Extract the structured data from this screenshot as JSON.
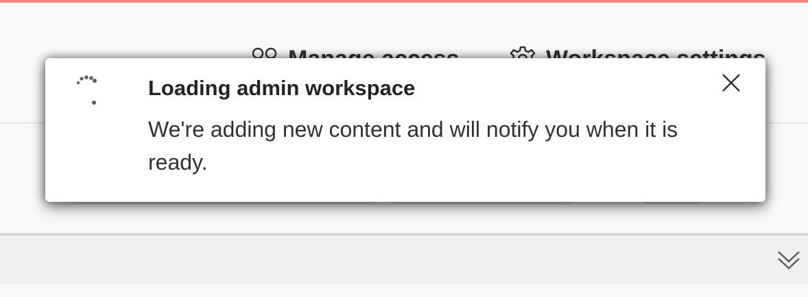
{
  "header": {
    "manage_access_label": "Manage access",
    "workspace_settings_label": "Workspace settings"
  },
  "toast": {
    "title": "Loading admin workspace",
    "message": "We're adding new content and will notify you when it is ready.",
    "spinner_icon": "loading-spinner-icon",
    "close_icon": "close-icon"
  },
  "collapse_bar": {
    "expand_icon": "double-chevron-down-icon"
  },
  "colors": {
    "top_accent": "#f08684",
    "page_background": "#faf9f8",
    "collapse_bar_background": "#f0f0f0",
    "toast_background": "#ffffff",
    "text_primary": "#252423"
  }
}
